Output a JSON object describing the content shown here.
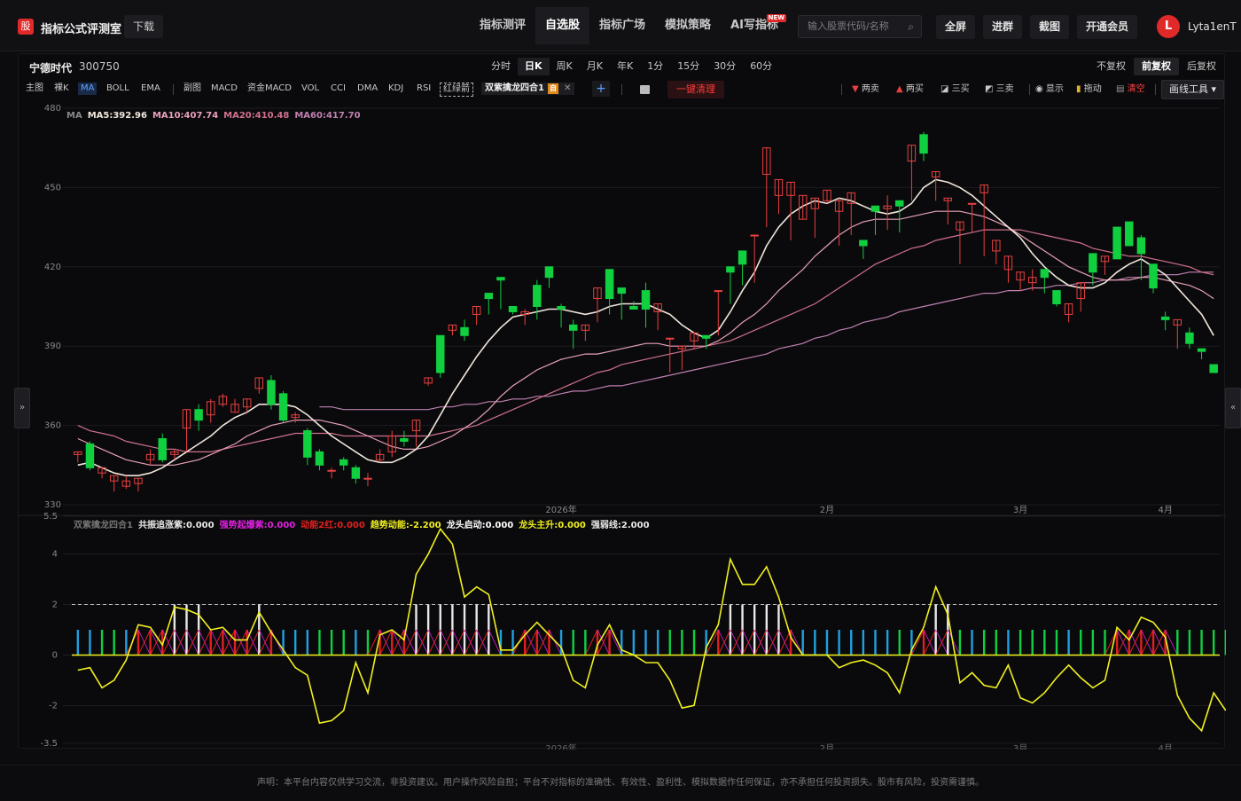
{
  "app": {
    "logo_char": "股",
    "title": "指标公式评测室",
    "download": "下载",
    "nav": [
      {
        "label": "指标测评",
        "active": false,
        "badge": ""
      },
      {
        "label": "自选股",
        "active": true,
        "badge": ""
      },
      {
        "label": "指标广场",
        "active": false,
        "badge": ""
      },
      {
        "label": "模拟策略",
        "active": false,
        "badge": ""
      },
      {
        "label": "AI写指标",
        "active": false,
        "badge": "NEW"
      }
    ],
    "search_placeholder": "输入股票代码/名称",
    "buttons": {
      "fullscreen": "全屏",
      "join_group": "进群",
      "screenshot": "截图",
      "vip": "开通会员"
    },
    "user": {
      "avatar": "L",
      "name": "Lyta1enT"
    }
  },
  "stock": {
    "name": "宁德时代",
    "code": "300750"
  },
  "periods": [
    {
      "label": "分时",
      "active": false
    },
    {
      "label": "日K",
      "active": true
    },
    {
      "label": "周K",
      "active": false
    },
    {
      "label": "月K",
      "active": false
    },
    {
      "label": "年K",
      "active": false
    },
    {
      "label": "1分",
      "active": false
    },
    {
      "label": "15分",
      "active": false
    },
    {
      "label": "30分",
      "active": false
    },
    {
      "label": "60分",
      "active": false
    }
  ],
  "adjust": [
    {
      "label": "不复权",
      "active": false
    },
    {
      "label": "前复权",
      "active": true
    },
    {
      "label": "后复权",
      "active": false
    }
  ],
  "indicators": {
    "main_label": "主图",
    "main": [
      "裸K",
      "MA",
      "BOLL",
      "EMA"
    ],
    "main_active": "MA",
    "sub_label": "副图",
    "sub": [
      "MACD",
      "资金MACD",
      "VOL",
      "CCI",
      "DMA",
      "KDJ",
      "RSI"
    ],
    "dashed": "红绿箭",
    "combo": {
      "label": "双紫擒龙四合1",
      "tag": "自"
    },
    "clean": "一键清理"
  },
  "controls": {
    "sell2": "两卖",
    "buy2": "两买",
    "buy3": "三买",
    "sell3": "三卖",
    "show": "显示",
    "drag": "拖动",
    "clear": "清空",
    "draw_tools": "画线工具"
  },
  "ma_legend": {
    "title": "MA",
    "items": [
      {
        "label": "MA5:392.96",
        "color": "#f0e6dc"
      },
      {
        "label": "MA10:407.74",
        "color": "#e8a0b8"
      },
      {
        "label": "MA20:410.48",
        "color": "#d0708c"
      },
      {
        "label": "MA60:417.70",
        "color": "#c080b0"
      }
    ]
  },
  "sub_legend": {
    "title": "双紫擒龙四合1",
    "items": [
      {
        "label": "共振追涨紫:0.000",
        "color": "#e8e8e8"
      },
      {
        "label": "强势起爆紫:0.000",
        "color": "#e020e0"
      },
      {
        "label": "动能2红:0.000",
        "color": "#e02020"
      },
      {
        "label": "趋势动能:-2.200",
        "color": "#f0f020"
      },
      {
        "label": "龙头启动:0.000",
        "color": "#ffffff"
      },
      {
        "label": "龙头主升:0.000",
        "color": "#f0f020"
      },
      {
        "label": "强弱线:2.000",
        "color": "#e8e8e8"
      }
    ]
  },
  "side_tabs": {
    "left": "»",
    "right": "«"
  },
  "footer": "声明：本平台内容仅供学习交流，非投资建议。用户操作风险自担；平台不对指标的准确性、有效性、盈利性、模拟数据作任何保证，亦不承担任何投资损失。股市有风险，投资需谨慎。",
  "colors": {
    "up": "#e84040",
    "down": "#10d040",
    "bg": "#0a0a0c",
    "accent": "#e02a2a"
  },
  "chart_data": [
    {
      "type": "candlestick",
      "ylim": [
        330,
        480
      ],
      "y_ticks": [
        480,
        450,
        420,
        390,
        360,
        330
      ],
      "x_labels": [
        "2026年",
        "2月",
        "3月",
        "4月"
      ],
      "candles": [
        [
          349,
          350,
          348,
          346
        ],
        [
          353,
          344,
          354,
          343
        ],
        [
          342,
          344,
          336,
          340
        ],
        [
          339,
          341,
          341,
          335
        ],
        [
          337,
          339,
          341,
          336
        ],
        [
          338,
          340,
          340,
          335
        ],
        [
          347,
          349,
          351,
          345
        ],
        [
          355,
          347,
          357,
          346
        ],
        [
          349,
          350,
          351,
          347
        ],
        [
          359,
          366,
          366,
          350
        ],
        [
          366,
          362,
          368,
          358
        ],
        [
          364,
          369,
          370,
          361
        ],
        [
          368,
          371,
          372,
          367
        ],
        [
          365,
          368,
          370,
          365
        ],
        [
          367,
          370,
          368,
          365
        ],
        [
          374,
          378,
          376,
          372
        ],
        [
          377,
          368,
          379,
          366
        ],
        [
          372,
          362,
          373,
          361
        ],
        [
          363,
          364,
          365,
          361
        ],
        [
          358,
          348,
          359,
          345
        ],
        [
          350,
          345,
          351,
          343
        ],
        [
          343,
          343,
          344,
          340
        ],
        [
          347,
          345,
          348,
          343
        ],
        [
          344,
          340,
          345,
          338
        ],
        [
          340,
          340,
          342,
          337
        ],
        [
          347,
          349,
          351,
          346
        ],
        [
          350,
          356,
          358,
          348
        ],
        [
          355,
          354,
          358,
          352
        ],
        [
          358,
          362,
          361,
          352
        ],
        [
          376,
          378,
          378,
          375
        ],
        [
          394,
          380,
          392,
          378
        ],
        [
          396,
          398,
          398,
          394
        ],
        [
          397,
          394,
          400,
          392
        ],
        [
          402,
          405,
          404,
          398
        ],
        [
          410,
          408,
          408,
          402
        ],
        [
          416,
          415,
          405,
          404
        ],
        [
          405,
          403,
          405,
          402
        ],
        [
          402,
          403,
          404,
          398
        ],
        [
          413,
          405,
          415,
          400
        ],
        [
          420,
          416,
          405,
          412
        ],
        [
          405,
          404,
          406,
          397
        ],
        [
          398,
          396,
          400,
          389
        ],
        [
          396,
          398,
          393,
          392
        ],
        [
          408,
          412,
          405,
          399
        ],
        [
          419,
          408,
          416,
          402
        ],
        [
          412,
          410,
          401,
          400
        ],
        [
          405,
          404,
          407,
          405
        ],
        [
          411,
          404,
          414,
          397
        ],
        [
          403,
          406,
          398,
          396
        ],
        [
          393,
          393,
          379,
          380
        ],
        [
          389,
          390,
          382,
          381
        ],
        [
          392,
          395,
          391,
          389
        ],
        [
          394,
          393,
          391,
          389
        ],
        [
          411,
          411,
          396,
          394
        ],
        [
          420,
          418,
          418,
          406
        ],
        [
          426,
          421,
          422,
          413
        ],
        [
          432,
          432,
          425,
          414
        ],
        [
          455,
          465,
          458,
          435
        ],
        [
          447,
          453,
          451,
          440
        ],
        [
          447,
          452,
          429,
          430
        ],
        [
          438,
          447,
          446,
          440
        ],
        [
          442,
          446,
          434,
          431
        ],
        [
          445,
          449,
          440,
          444
        ],
        [
          441,
          445,
          446,
          428
        ],
        [
          444,
          448,
          436,
          432
        ],
        [
          430,
          428,
          426,
          423
        ],
        [
          443,
          441,
          434,
          432
        ],
        [
          442,
          443,
          447,
          434
        ],
        [
          445,
          443,
          434,
          433
        ],
        [
          460,
          466,
          462,
          445
        ],
        [
          470,
          463,
          471,
          460
        ],
        [
          454,
          456,
          445,
          445
        ],
        [
          445,
          446,
          434,
          436
        ],
        [
          434,
          437,
          424,
          421
        ],
        [
          444,
          444,
          441,
          433
        ],
        [
          448,
          451,
          427,
          424
        ],
        [
          426,
          430,
          425,
          421
        ],
        [
          419,
          424,
          422,
          414
        ],
        [
          415,
          418,
          414,
          411
        ],
        [
          414,
          416,
          419,
          411
        ],
        [
          419,
          416,
          413,
          410
        ],
        [
          411,
          406,
          403,
          405
        ],
        [
          402,
          406,
          405,
          399
        ],
        [
          408,
          414,
          406,
          403
        ],
        [
          425,
          418,
          419,
          413
        ],
        [
          422,
          424,
          422,
          417
        ],
        [
          435,
          423,
          419,
          425
        ],
        [
          437,
          428,
          431,
          438
        ],
        [
          431,
          425,
          432,
          415
        ],
        [
          421,
          412,
          412,
          410
        ],
        [
          401,
          400,
          403,
          396
        ],
        [
          398,
          400,
          392,
          389
        ],
        [
          395,
          391,
          397,
          389
        ],
        [
          389,
          388,
          386,
          385
        ],
        [
          383,
          380,
          382,
          380
        ]
      ],
      "ma5": [
        345,
        346,
        344,
        342,
        341,
        341,
        342,
        344,
        347,
        350,
        353,
        356,
        360,
        363,
        365,
        368,
        368,
        368,
        367,
        364,
        360,
        356,
        353,
        350,
        347,
        346,
        346,
        348,
        351,
        356,
        364,
        372,
        379,
        386,
        392,
        397,
        401,
        402,
        403,
        404,
        404,
        403,
        402,
        403,
        405,
        406,
        406,
        406,
        404,
        402,
        398,
        395,
        393,
        396,
        403,
        411,
        418,
        428,
        435,
        440,
        443,
        445,
        444,
        446,
        445,
        443,
        441,
        440,
        441,
        444,
        450,
        453,
        452,
        450,
        447,
        443,
        439,
        435,
        431,
        425,
        420,
        416,
        413,
        412,
        412,
        414,
        418,
        421,
        423,
        420,
        417,
        412,
        407,
        402,
        394
      ],
      "ma10": [
        355,
        353,
        351,
        349,
        347,
        346,
        345,
        345,
        345,
        346,
        347,
        349,
        351,
        353,
        356,
        358,
        360,
        361,
        362,
        362,
        362,
        361,
        360,
        358,
        356,
        354,
        352,
        351,
        351,
        352,
        354,
        356,
        359,
        362,
        366,
        371,
        375,
        378,
        381,
        383,
        385,
        386,
        387,
        387,
        388,
        389,
        390,
        391,
        391,
        390,
        390,
        390,
        390,
        392,
        395,
        399,
        402,
        406,
        411,
        415,
        419,
        424,
        428,
        432,
        435,
        437,
        438,
        438,
        438,
        439,
        440,
        441,
        441,
        441,
        440,
        439,
        437,
        435,
        432,
        429,
        426,
        423,
        420,
        418,
        416,
        415,
        415,
        415,
        416,
        416,
        415,
        414,
        413,
        411,
        408
      ],
      "ma20": [
        360,
        358,
        357,
        356,
        354,
        353,
        352,
        351,
        351,
        350,
        350,
        350,
        351,
        352,
        353,
        354,
        355,
        356,
        357,
        357,
        357,
        357,
        356,
        356,
        356,
        356,
        356,
        356,
        356,
        356,
        357,
        358,
        359,
        360,
        362,
        364,
        366,
        368,
        370,
        372,
        374,
        376,
        378,
        380,
        381,
        383,
        384,
        385,
        386,
        387,
        388,
        389,
        390,
        391,
        392,
        394,
        396,
        398,
        400,
        402,
        404,
        406,
        409,
        412,
        415,
        418,
        421,
        423,
        425,
        427,
        428,
        430,
        431,
        432,
        433,
        434,
        434,
        434,
        434,
        433,
        432,
        431,
        430,
        429,
        427,
        426,
        425,
        424,
        424,
        423,
        422,
        421,
        420,
        418,
        417
      ],
      "ma60": [
        null,
        null,
        null,
        null,
        null,
        null,
        null,
        null,
        null,
        null,
        null,
        null,
        null,
        null,
        null,
        null,
        null,
        null,
        null,
        null,
        367,
        367,
        366,
        366,
        366,
        366,
        366,
        366,
        366,
        366,
        367,
        367,
        368,
        368,
        369,
        369,
        370,
        370,
        371,
        371,
        372,
        373,
        373,
        374,
        375,
        375,
        376,
        377,
        378,
        379,
        380,
        381,
        382,
        383,
        384,
        385,
        386,
        387,
        389,
        390,
        391,
        393,
        394,
        396,
        397,
        399,
        400,
        401,
        403,
        404,
        405,
        406,
        407,
        408,
        409,
        410,
        410,
        411,
        411,
        412,
        412,
        413,
        413,
        414,
        414,
        415,
        415,
        416,
        416,
        417,
        417,
        417,
        418,
        418,
        418
      ]
    },
    {
      "type": "indicator",
      "ylim": [
        -3.5,
        5.5
      ],
      "y_ticks": [
        5.5,
        4.0,
        2.0,
        0.0,
        -2.0,
        -3.5
      ],
      "strength_line": 2.0,
      "trend": [
        -0.6,
        -0.5,
        -1.3,
        -1.0,
        -0.2,
        1.2,
        1.1,
        0.4,
        1.9,
        1.8,
        1.6,
        1.0,
        1.1,
        0.6,
        0.6,
        1.7,
        0.9,
        0.2,
        -0.5,
        -0.8,
        -2.7,
        -2.6,
        -2.2,
        -0.3,
        -1.5,
        0.8,
        1.0,
        0.6,
        3.2,
        4.0,
        5.0,
        4.4,
        2.3,
        2.7,
        2.4,
        0.2,
        0.2,
        0.8,
        1.3,
        0.8,
        0.3,
        -1.0,
        -1.3,
        0.4,
        1.2,
        0.2,
        0.0,
        -0.3,
        -0.3,
        -1.0,
        -2.1,
        -2.0,
        0.3,
        1.2,
        3.8,
        2.8,
        2.8,
        3.5,
        2.3,
        0.7,
        0.0,
        0.0,
        0.0,
        -0.5,
        -0.3,
        -0.2,
        -0.4,
        -0.7,
        -1.5,
        0.2,
        1.1,
        2.7,
        1.6,
        -1.1,
        -0.7,
        -1.2,
        -1.3,
        -0.4,
        -1.7,
        -1.9,
        -1.5,
        -0.9,
        -0.4,
        -0.9,
        -1.3,
        -1.0,
        1.1,
        0.6,
        1.5,
        1.3,
        0.7,
        -1.6,
        -2.5,
        -3.0,
        -1.5,
        -2.2
      ]
    }
  ]
}
